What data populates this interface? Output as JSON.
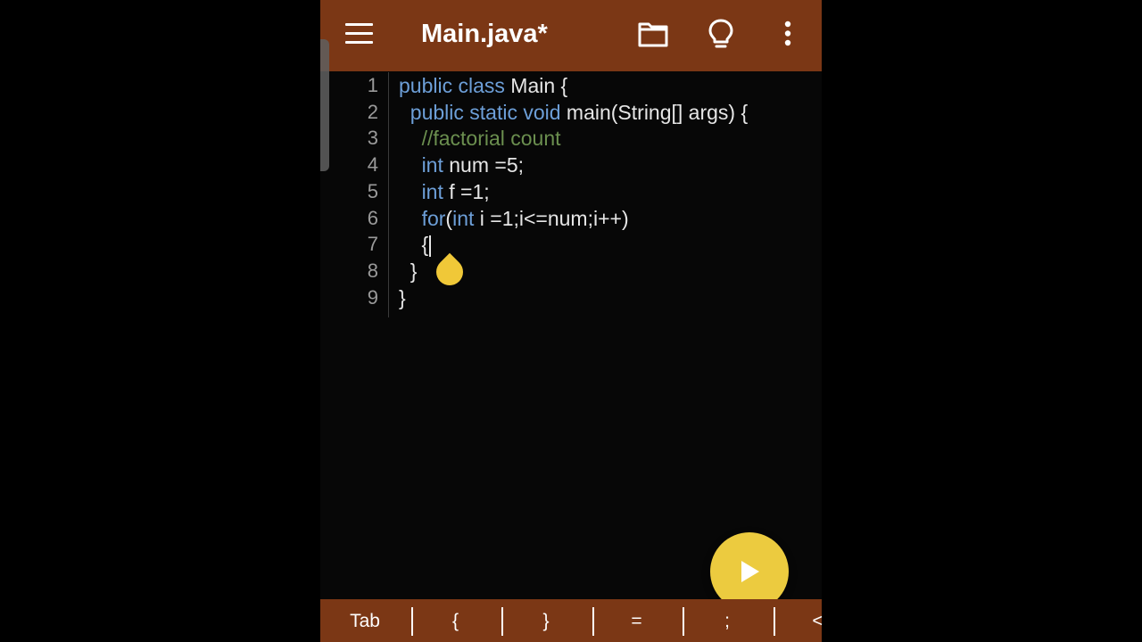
{
  "app": {
    "title": "Main.java*",
    "toolbar_icons": [
      "menu-icon",
      "folder-icon",
      "lightbulb-icon",
      "more-vertical-icon"
    ]
  },
  "editor": {
    "lines": [
      {
        "num": "1",
        "tokens": [
          {
            "t": "kw",
            "v": "public class"
          },
          {
            "t": "tx",
            "v": " Main {"
          }
        ]
      },
      {
        "num": "2",
        "tokens": [
          {
            "t": "tx",
            "v": "  "
          },
          {
            "t": "kw",
            "v": "public static void"
          },
          {
            "t": "tx",
            "v": " main(String[] args) {"
          }
        ]
      },
      {
        "num": "3",
        "tokens": [
          {
            "t": "tx",
            "v": "    "
          },
          {
            "t": "cm",
            "v": "//factorial count"
          }
        ]
      },
      {
        "num": "4",
        "tokens": [
          {
            "t": "tx",
            "v": "    "
          },
          {
            "t": "kw",
            "v": "int"
          },
          {
            "t": "tx",
            "v": " num =5;"
          }
        ]
      },
      {
        "num": "5",
        "tokens": [
          {
            "t": "tx",
            "v": "    "
          },
          {
            "t": "kw",
            "v": "int"
          },
          {
            "t": "tx",
            "v": " f =1;"
          }
        ]
      },
      {
        "num": "6",
        "tokens": [
          {
            "t": "tx",
            "v": "    "
          },
          {
            "t": "kw",
            "v": "for"
          },
          {
            "t": "tx",
            "v": "("
          },
          {
            "t": "kw",
            "v": "int"
          },
          {
            "t": "tx",
            "v": " i =1;i<=num;i++)"
          }
        ]
      },
      {
        "num": "7",
        "tokens": [
          {
            "t": "tx",
            "v": "    {"
          }
        ]
      },
      {
        "num": "8",
        "tokens": [
          {
            "t": "tx",
            "v": "  }"
          }
        ]
      },
      {
        "num": "9",
        "tokens": [
          {
            "t": "tx",
            "v": "}"
          }
        ]
      }
    ]
  },
  "run_button": {
    "icon": "play-icon"
  },
  "keybar": {
    "keys": [
      "Tab",
      "{",
      "}",
      "=",
      ";",
      "<"
    ]
  },
  "colors": {
    "toolbar": "#7b3715",
    "keyword": "#6d9fd8",
    "comment": "#6b8f4f",
    "fab": "#eccb3f"
  }
}
